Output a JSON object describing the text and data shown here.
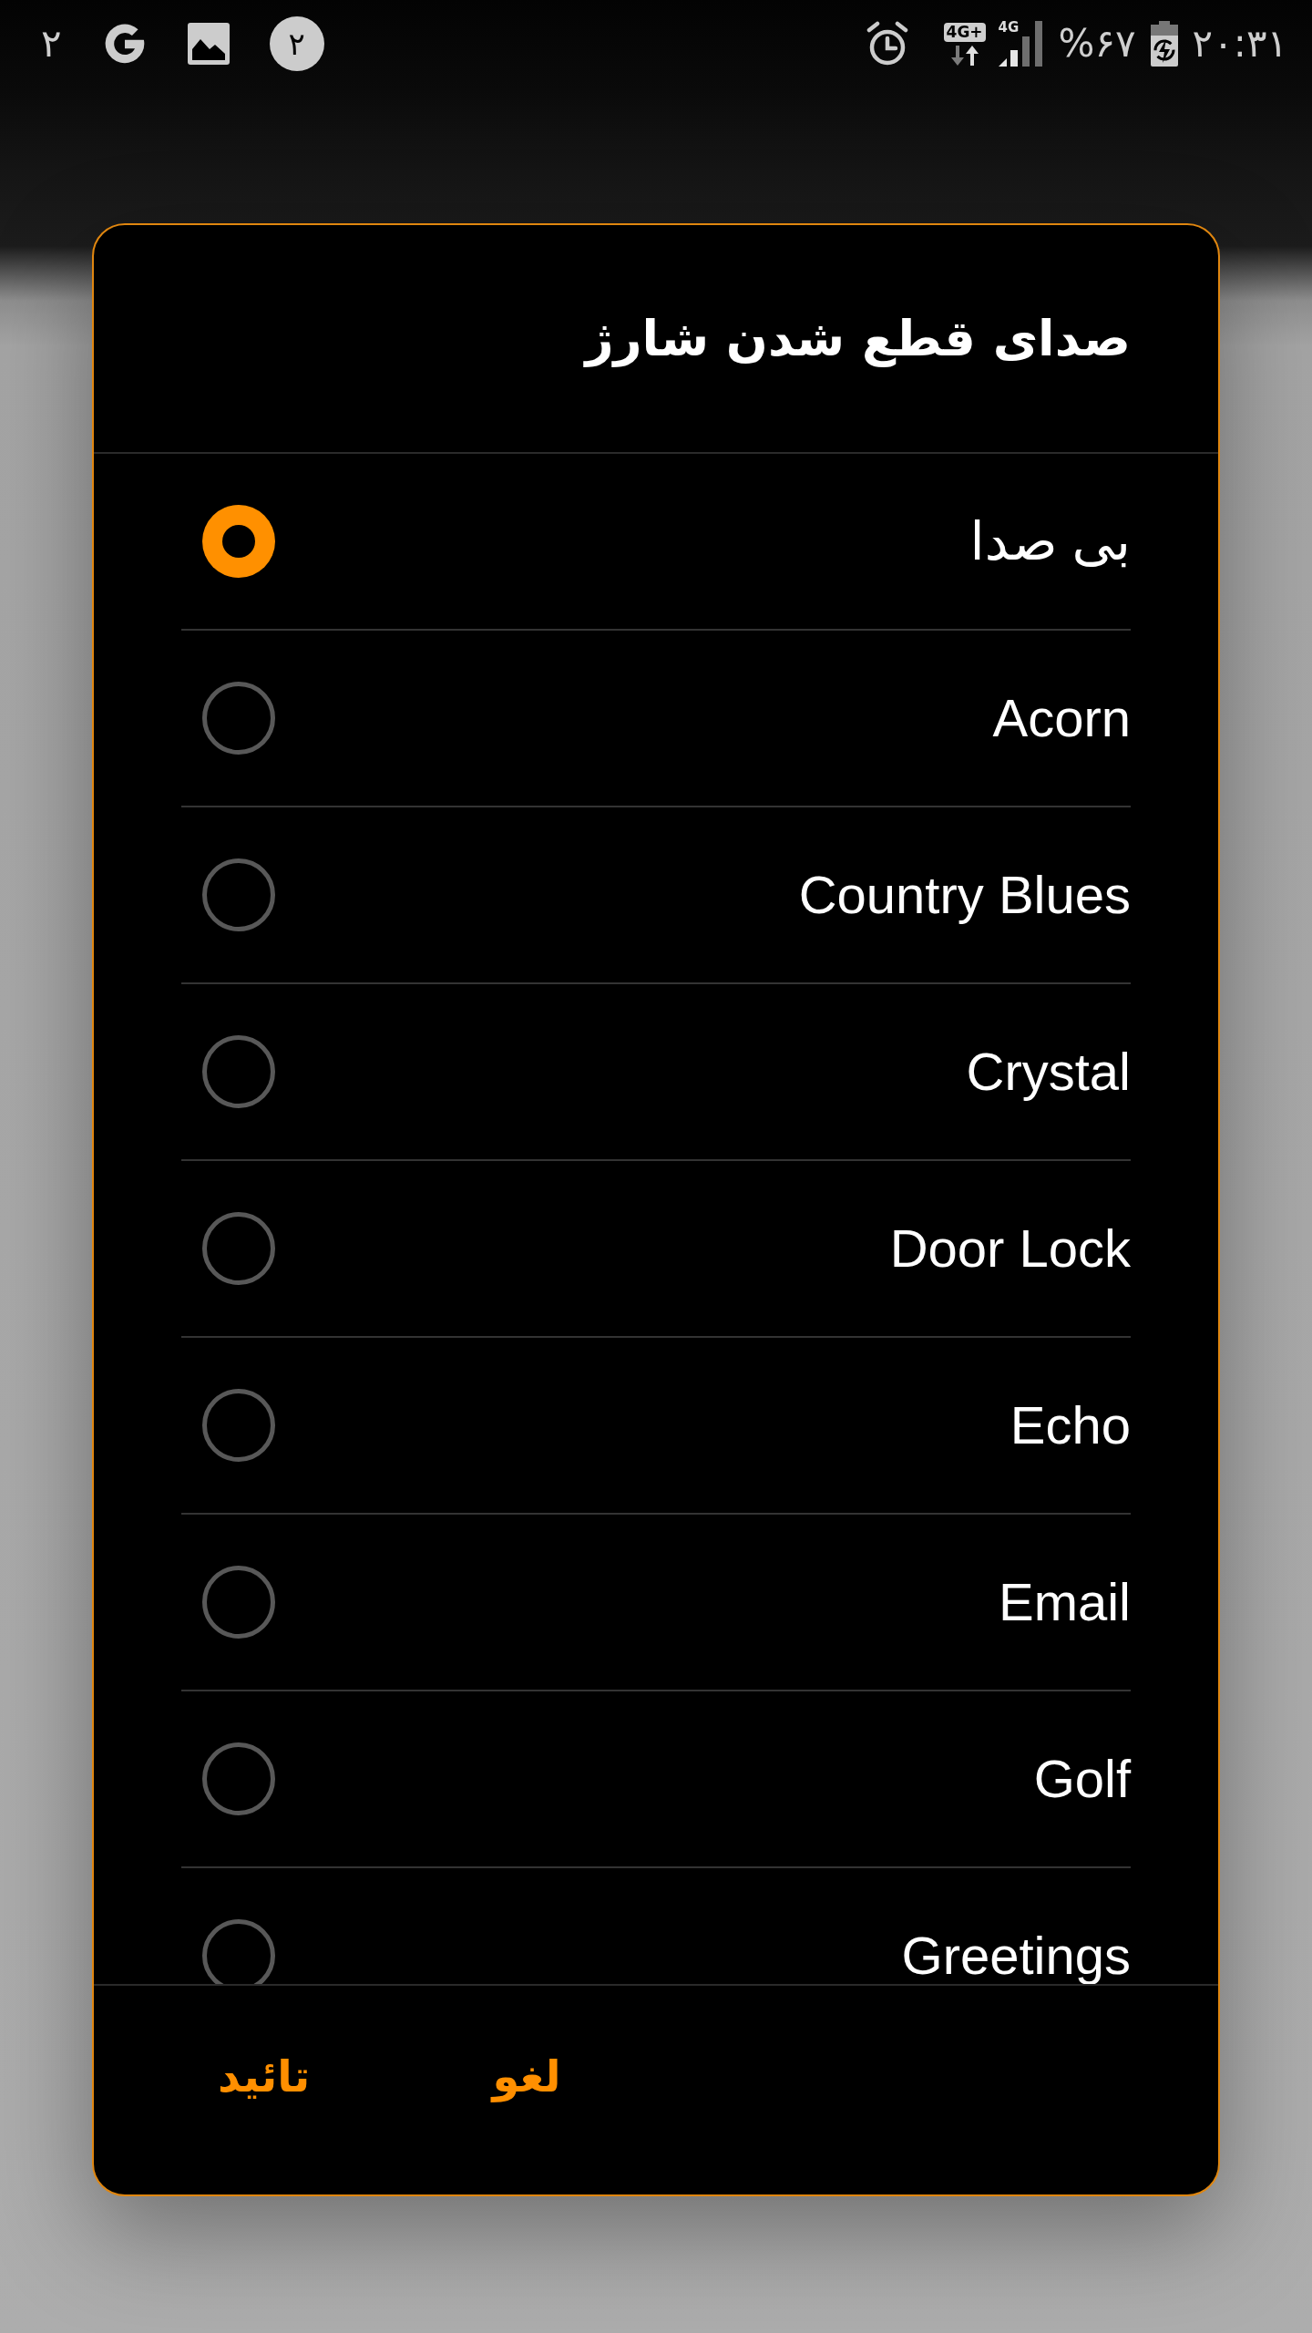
{
  "status_bar": {
    "notification_count": "۲",
    "badge": "۲",
    "network_type": "4G+",
    "signal_type": "4G",
    "battery": "%۶۷",
    "time": "۲۰:۳۱"
  },
  "dialog": {
    "title": "صدای قطع شدن شارژ",
    "options": [
      {
        "label": "بی صدا",
        "selected": true
      },
      {
        "label": "Acorn",
        "selected": false
      },
      {
        "label": "Country Blues",
        "selected": false
      },
      {
        "label": "Crystal",
        "selected": false
      },
      {
        "label": "Door Lock",
        "selected": false
      },
      {
        "label": "Echo",
        "selected": false
      },
      {
        "label": "Email",
        "selected": false
      },
      {
        "label": "Golf",
        "selected": false
      },
      {
        "label": "Greetings",
        "selected": false
      }
    ],
    "buttons": [
      {
        "label": "لغو"
      },
      {
        "label": "تائید"
      }
    ]
  }
}
